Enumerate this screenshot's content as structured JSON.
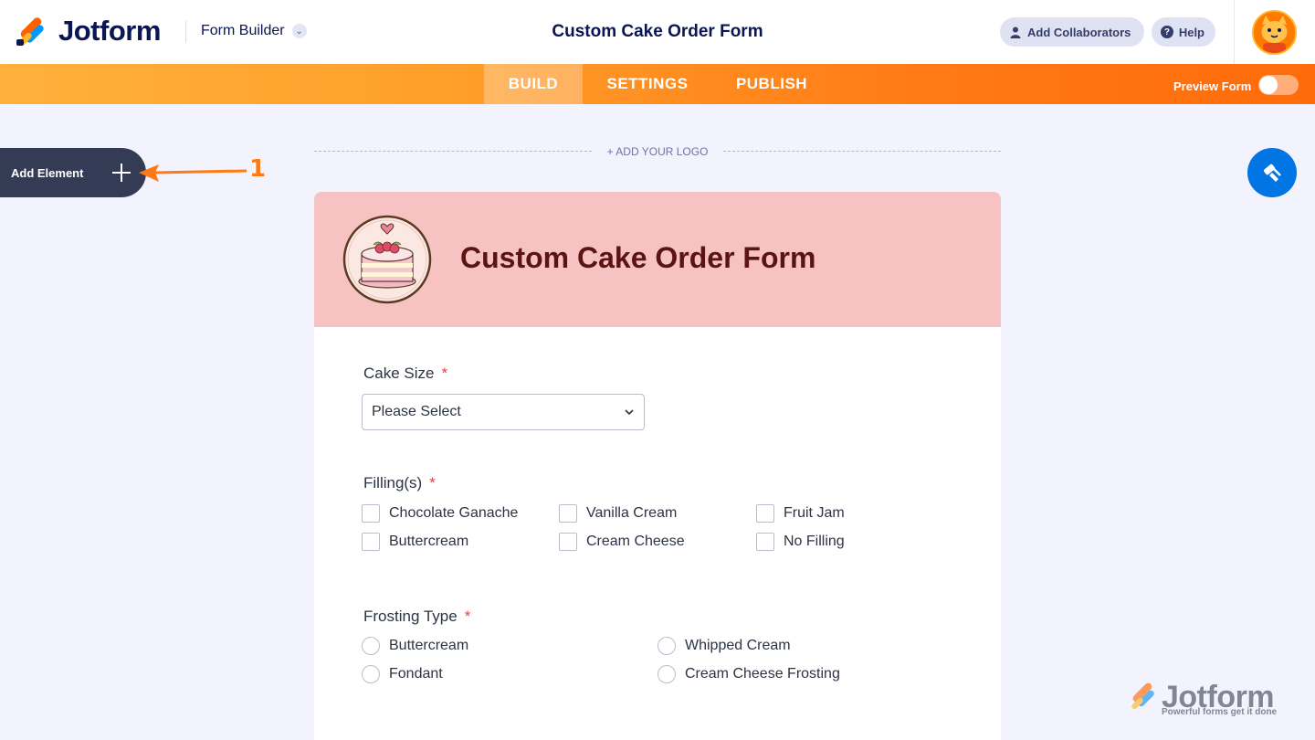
{
  "header": {
    "brand": "Jotform",
    "builder_menu": "Form Builder",
    "form_title": "Custom Cake Order Form",
    "add_collaborators": "Add Collaborators",
    "help": "Help"
  },
  "nav": {
    "tabs": [
      {
        "label": "BUILD",
        "active": true
      },
      {
        "label": "SETTINGS",
        "active": false
      },
      {
        "label": "PUBLISH",
        "active": false
      }
    ],
    "preview_label": "Preview Form",
    "preview_on": false
  },
  "left_panel": {
    "add_element": "Add Element",
    "annotation_number": "1"
  },
  "canvas": {
    "add_logo": "+ ADD YOUR LOGO"
  },
  "form": {
    "heading": "Custom Cake Order Form",
    "cake_size": {
      "label": "Cake Size",
      "required_mark": "*",
      "placeholder": "Please Select"
    },
    "fillings": {
      "label": "Filling(s)",
      "required_mark": "*",
      "options": [
        "Chocolate Ganache",
        "Vanilla Cream",
        "Fruit Jam",
        "Buttercream",
        "Cream Cheese",
        "No Filling"
      ]
    },
    "frosting": {
      "label": "Frosting Type",
      "required_mark": "*",
      "options": [
        "Buttercream",
        "Whipped Cream",
        "Fondant",
        "Cream Cheese Frosting"
      ]
    }
  },
  "watermark": {
    "brand": "Jotform",
    "tagline": "Powerful forms get it done"
  },
  "colors": {
    "nav_gradient_start": "#ffb13b",
    "nav_gradient_end": "#ff6b0b",
    "header_band": "#f7c3c2",
    "title_color": "#5a1414",
    "required": "#f23a3c",
    "paint_button": "#0075e3",
    "add_element_bg": "#343c55"
  }
}
